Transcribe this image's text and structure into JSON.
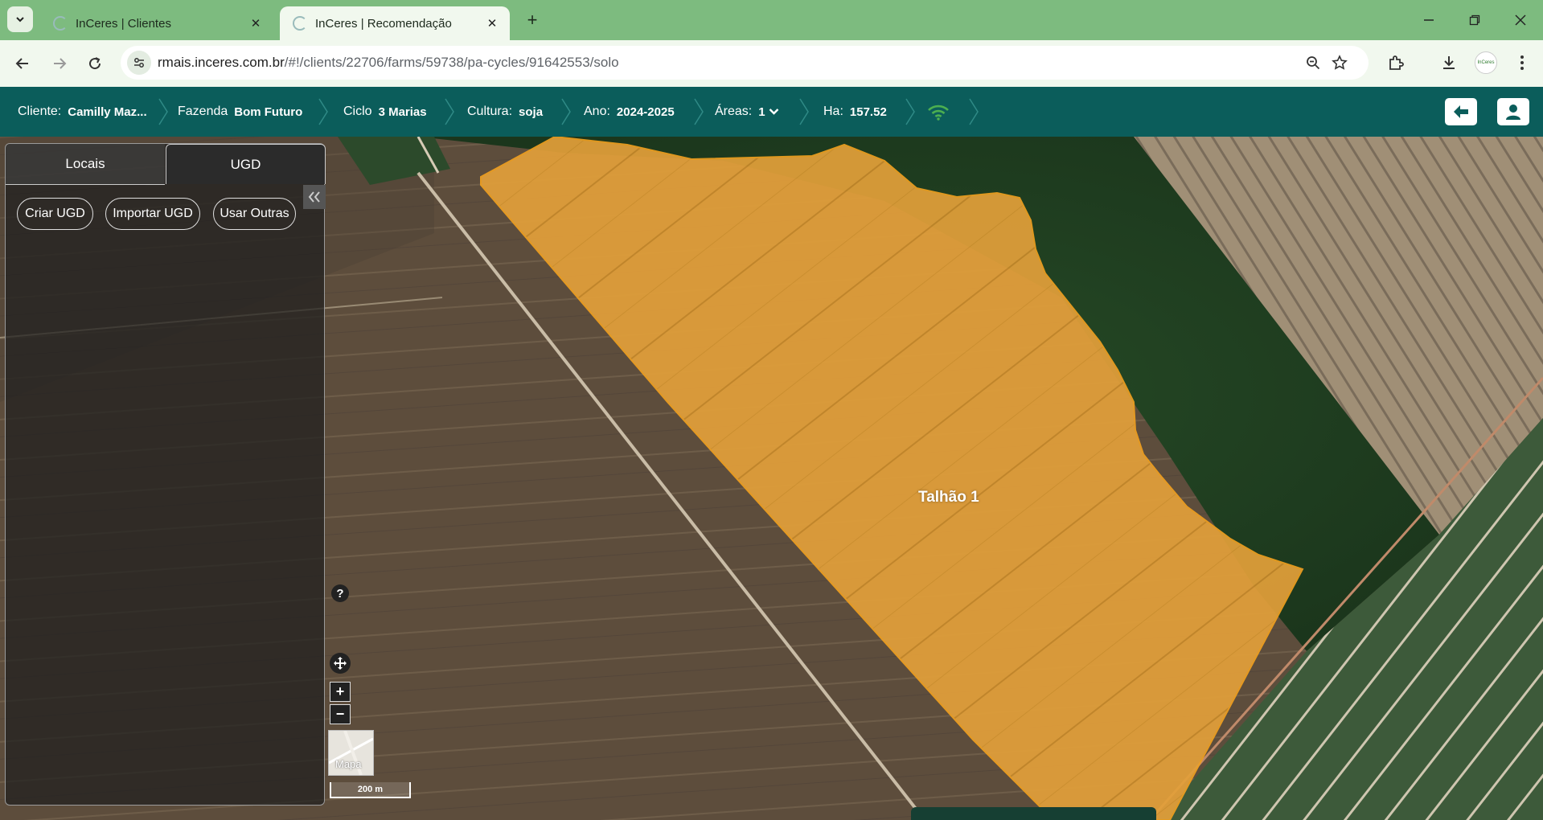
{
  "browser": {
    "tabs": [
      {
        "title": "InCeres | Clientes",
        "active": false
      },
      {
        "title": "InCeres | Recomendação",
        "active": true
      }
    ],
    "url_host": "rmais.inceres.com.br",
    "url_path": "/#!/clients/22706/farms/59738/pa-cycles/91642553/solo",
    "profile_text": "InCeres"
  },
  "header": {
    "cliente_label": "Cliente:",
    "cliente_value": "Camilly Maz...",
    "fazenda_label": "Fazenda",
    "fazenda_value": "Bom Futuro",
    "ciclo_label": "Ciclo",
    "ciclo_value": "3 Marias",
    "cultura_label": "Cultura:",
    "cultura_value": "soja",
    "ano_label": "Ano:",
    "ano_value": "2024-2025",
    "areas_label": "Áreas:",
    "areas_value": "1",
    "ha_label": "Ha:",
    "ha_value": "157.52",
    "accent_color": "#0b5d5b",
    "wifi_color": "#4caf50"
  },
  "panel": {
    "tabs": [
      "Locais",
      "UGD"
    ],
    "active_tab": "UGD",
    "buttons": [
      "Criar UGD",
      "Importar UGD",
      "Usar Outras"
    ]
  },
  "map": {
    "field_label": "Talhão 1",
    "field_color": "#e8a02a",
    "help_label": "?",
    "zoom_in": "+",
    "zoom_out": "−",
    "basemap_label": "Mapa",
    "scale_label": "200 m"
  }
}
